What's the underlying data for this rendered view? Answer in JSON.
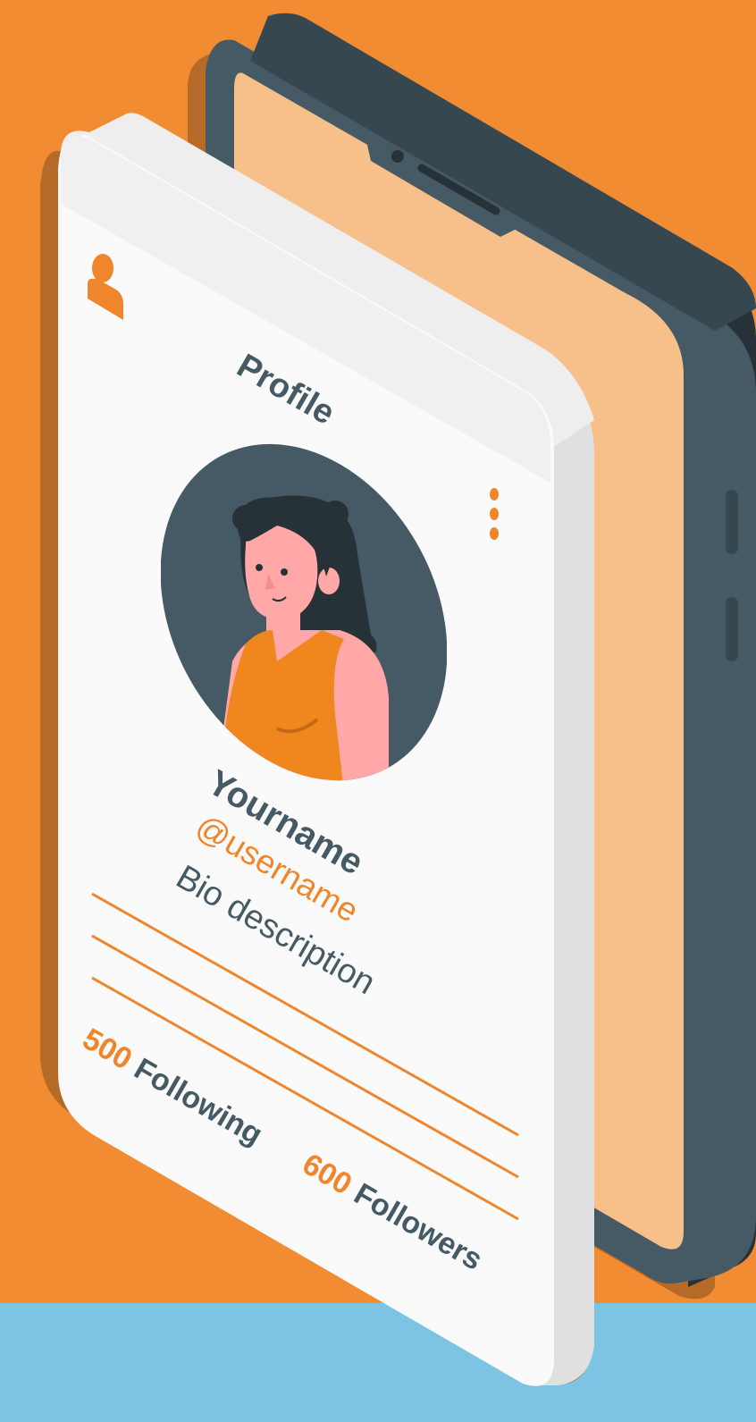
{
  "screen": {
    "title": "Profile",
    "display_name": "Yourname",
    "username": "@username",
    "bio": "Bio description",
    "stats": [
      {
        "value": "500",
        "label": "Following"
      },
      {
        "value": "600",
        "label": "Followers"
      }
    ]
  },
  "icons": {
    "user": "user-icon",
    "more": "more-vertical-icon",
    "avatar": "woman-avatar-illustration"
  },
  "colors": {
    "background": "#F28C33",
    "floor": "#7DC4E4",
    "phone_body": "#37474F",
    "phone_screen": "#F7BF8A",
    "card": "#FAFAFA",
    "accent": "#F0862C",
    "text_dark": "#455A64"
  }
}
